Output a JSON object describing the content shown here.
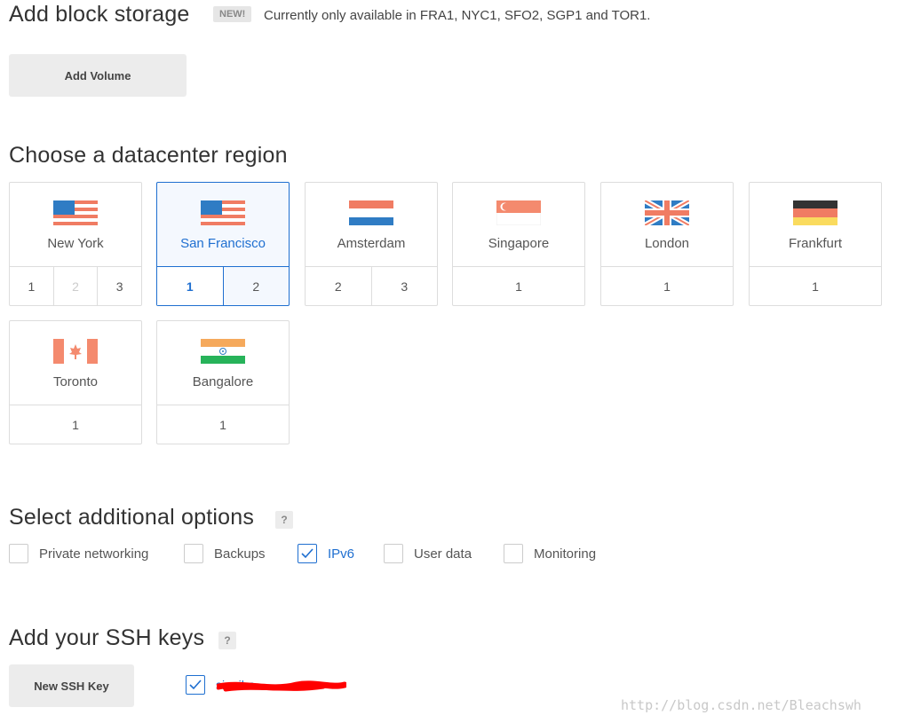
{
  "block_storage": {
    "title": "Add block storage",
    "badge": "NEW!",
    "note": "Currently only available in FRA1, NYC1, SFO2, SGP1 and TOR1.",
    "add_volume_label": "Add Volume"
  },
  "region": {
    "title": "Choose a datacenter region",
    "selected": "San Francisco",
    "cards": [
      {
        "name": "New York",
        "flag": "us-flag-icon",
        "numbers": [
          "1",
          "2",
          "3"
        ],
        "disabled": [
          "2"
        ]
      },
      {
        "name": "San Francisco",
        "flag": "us-flag-icon",
        "numbers": [
          "1",
          "2"
        ],
        "active": "1"
      },
      {
        "name": "Amsterdam",
        "flag": "nl-flag-icon",
        "numbers": [
          "2",
          "3"
        ]
      },
      {
        "name": "Singapore",
        "flag": "sg-flag-icon",
        "numbers": [
          "1"
        ]
      },
      {
        "name": "London",
        "flag": "uk-flag-icon",
        "numbers": [
          "1"
        ]
      },
      {
        "name": "Frankfurt",
        "flag": "de-flag-icon",
        "numbers": [
          "1"
        ]
      },
      {
        "name": "Toronto",
        "flag": "ca-flag-icon",
        "numbers": [
          "1"
        ]
      },
      {
        "name": "Bangalore",
        "flag": "in-flag-icon",
        "numbers": [
          "1"
        ]
      }
    ]
  },
  "options": {
    "title": "Select additional options",
    "help": "?",
    "items": [
      {
        "label": "Private networking",
        "checked": false
      },
      {
        "label": "Backups",
        "checked": false
      },
      {
        "label": "IPv6",
        "checked": true
      },
      {
        "label": "User data",
        "checked": false
      },
      {
        "label": "Monitoring",
        "checked": false
      }
    ]
  },
  "ssh": {
    "title": "Add your SSH keys",
    "help": "?",
    "new_key_label": "New SSH Key",
    "key_label": "sinaiha...",
    "key_checked": true
  },
  "watermark": "http://blog.csdn.net/Bleachswh",
  "colors": {
    "accent": "#1f6fd0",
    "border": "#dddddd",
    "button_bg": "#ececec"
  }
}
